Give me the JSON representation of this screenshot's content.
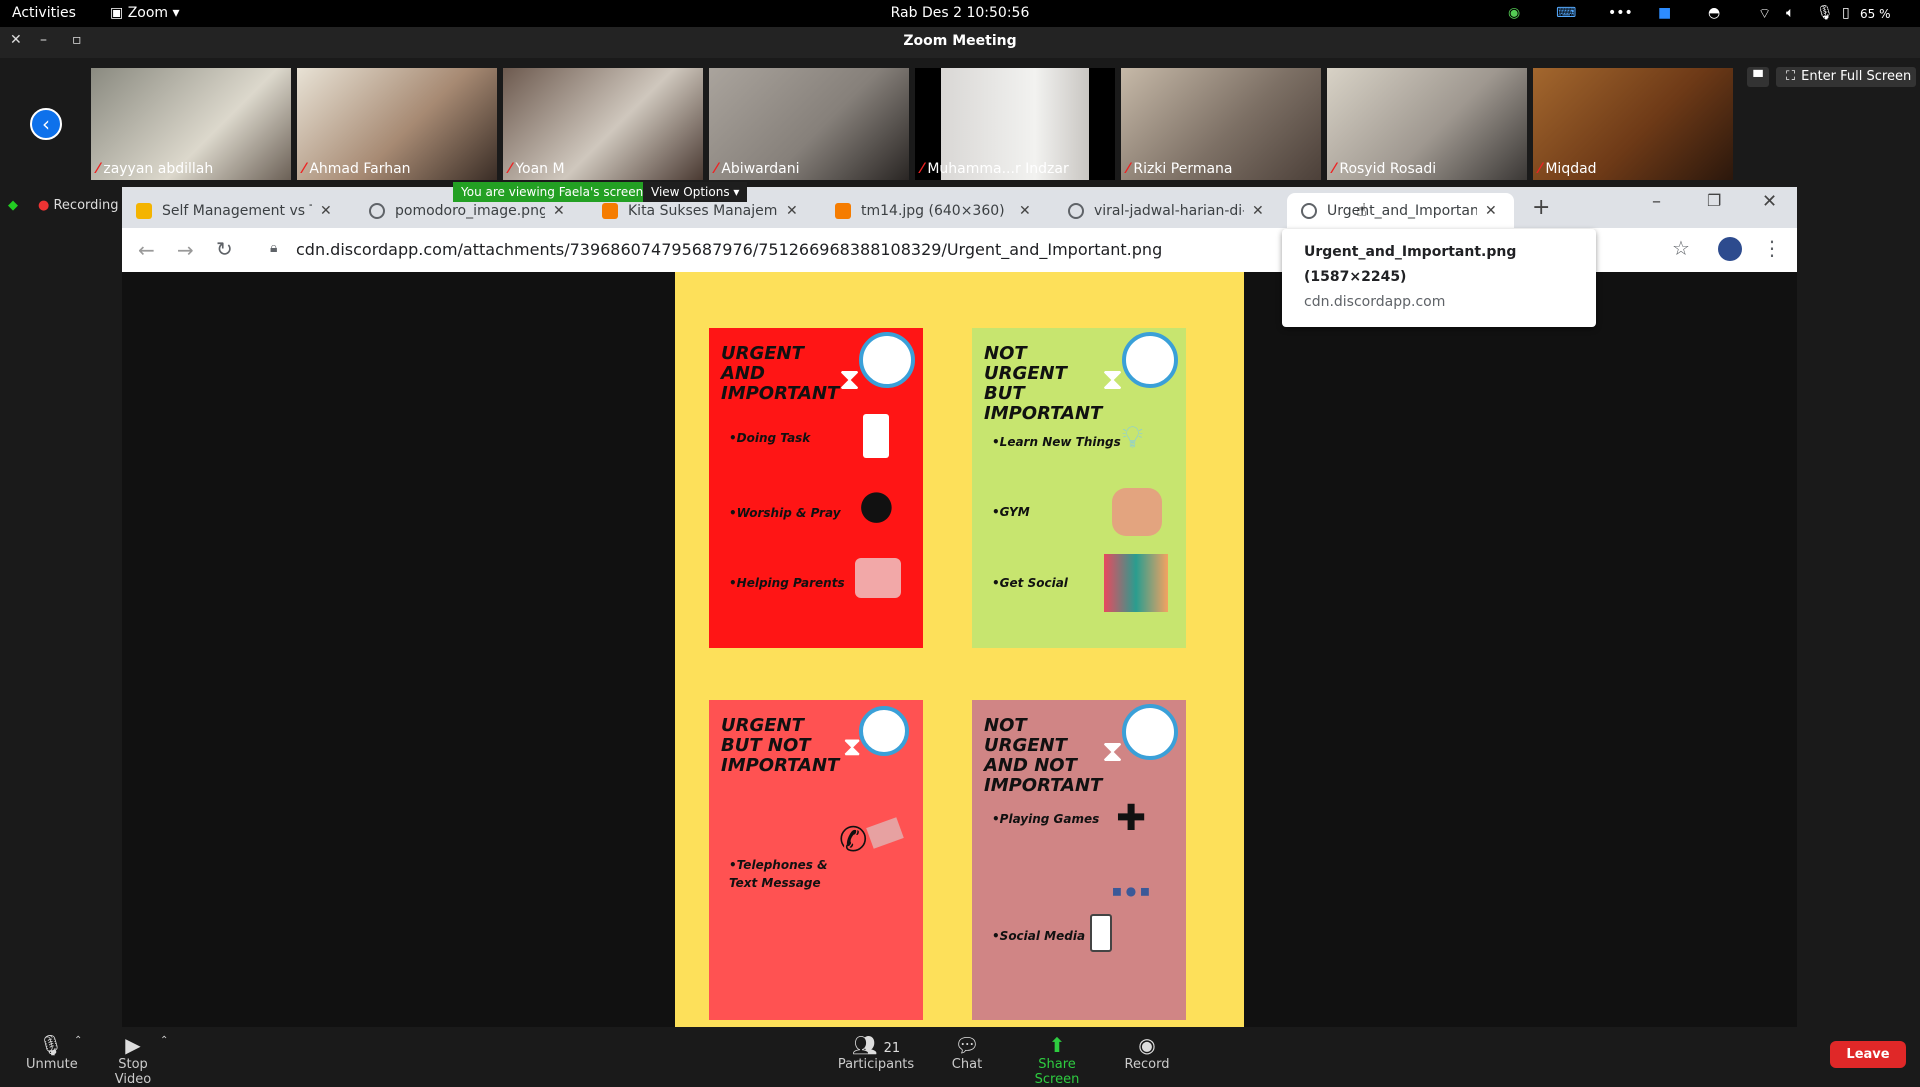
{
  "topbar": {
    "activities": "Activities",
    "app_menu": "Zoom",
    "clock": "Rab Des 2  10:50:56",
    "battery": "65 %"
  },
  "zoom_window": {
    "title": "Zoom Meeting",
    "enter_full_screen": "Enter Full Screen",
    "recording": "Recording",
    "viewing_banner": "You are viewing Faela's screen",
    "view_options": "View Options"
  },
  "participants": [
    {
      "name": "zayyan abdillah"
    },
    {
      "name": "Ahmad Farhan"
    },
    {
      "name": "Yoan M"
    },
    {
      "name": "Abiwardani"
    },
    {
      "name": "Muhamma...r Indzar"
    },
    {
      "name": "Rizki Permana"
    },
    {
      "name": "Rosyid Rosadi"
    },
    {
      "name": "Miqdad"
    }
  ],
  "browser": {
    "tabs": [
      {
        "title": "Self Management vs Ti",
        "favicon_color": "#f4b400"
      },
      {
        "title": "pomodoro_image.png",
        "favicon_color": "#5f6368"
      },
      {
        "title": "Kita Sukses Manajemen",
        "favicon_color": "#f57c00"
      },
      {
        "title": "tm14.jpg (640×360)",
        "favicon_color": "#f57c00"
      },
      {
        "title": "viral-jadwal-harian-di-m",
        "favicon_color": "#5f6368"
      },
      {
        "title": "Urgent_and_Important.",
        "favicon_color": "#5f6368"
      }
    ],
    "url": "cdn.discordapp.com/attachments/739686074795687976/751266968388108329/Urgent_and_Important.png",
    "tooltip": {
      "title": "Urgent_and_Important.png",
      "dims": "(1587×2245)",
      "domain": "cdn.discordapp.com"
    }
  },
  "poster": {
    "quadrants": [
      {
        "title": "Urgent and Important",
        "color": "#ff1515",
        "items": [
          "Doing Task",
          "Worship & Pray",
          "Helping Parents"
        ]
      },
      {
        "title": "Not Urgent but Important",
        "color": "#c7e56f",
        "items": [
          "Learn New Things",
          "GYM",
          "Get Social"
        ]
      },
      {
        "title": "Urgent but not Important",
        "color": "#ff5252",
        "items": [
          "Telephones & Text Message"
        ]
      },
      {
        "title": "Not Urgent and not Important",
        "color": "#d08585",
        "items": [
          "Playing Games",
          "Social Media"
        ]
      }
    ]
  },
  "bottom_bar": {
    "unmute": "Unmute",
    "stop_video": "Stop Video",
    "participants": "Participants",
    "participant_count": "21",
    "chat": "Chat",
    "share_screen": "Share Screen",
    "record": "Record",
    "leave": "Leave"
  }
}
